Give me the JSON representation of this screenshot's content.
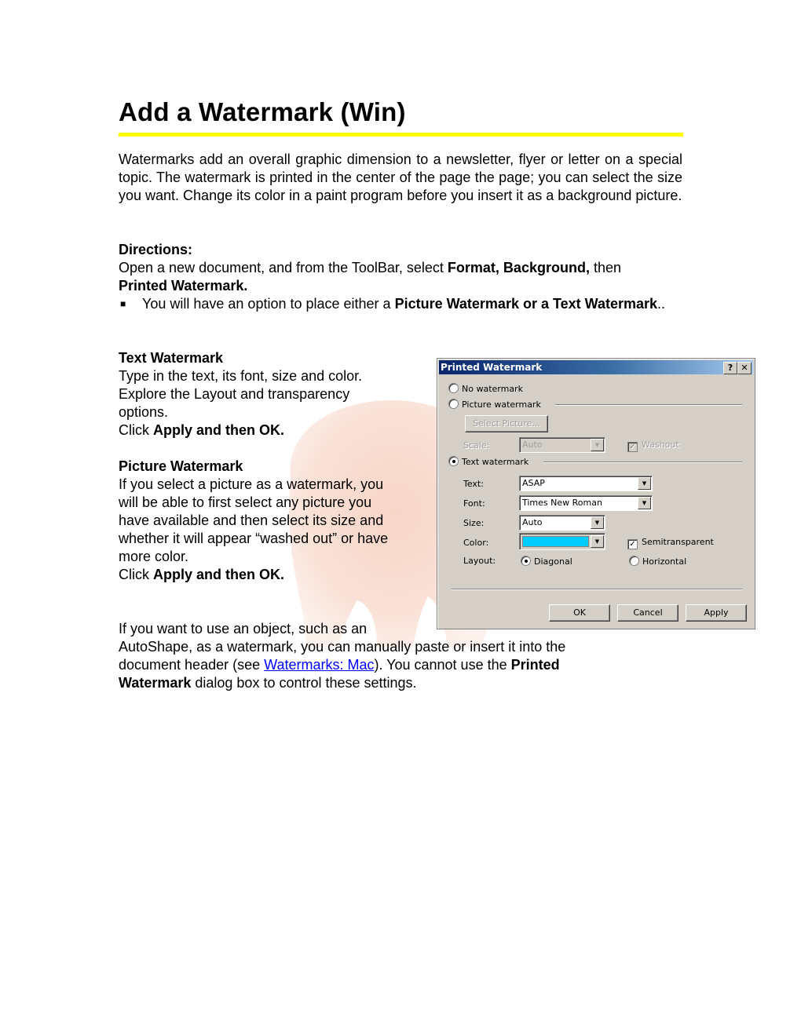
{
  "document": {
    "title": "Add a Watermark (Win)",
    "intro": "Watermarks add an overall graphic dimension to a newsletter, flyer or letter on a special topic. The watermark is printed in the center of the page the page; you can select the size you want. Change its color in a paint program before you insert it as a background picture.",
    "directions": {
      "heading": "Directions:",
      "line1_prefix": "Open a new document, and from the ToolBar, select ",
      "line1_bold": "Format, Background,",
      "line1_suffix": " then",
      "line2_bold": "Printed Watermark.",
      "bullet_glyph": "■",
      "bullet_prefix": "You will have an option to place either a ",
      "bullet_bold": "Picture Watermark or a Text Watermark",
      "bullet_suffix": ".."
    },
    "text_watermark": {
      "heading": "Text Watermark",
      "lines": [
        "Type in the text, its font, size and color.",
        "Explore the Layout and transparency",
        "options."
      ],
      "click_prefix": "Click ",
      "click_bold": "Apply and then OK."
    },
    "picture_watermark": {
      "heading": "Picture Watermark",
      "lines": [
        "If you select a picture as a watermark, you",
        "will be able to first select any picture you",
        "have available and then select its size and",
        "whether it will appear “washed out” or have",
        "more color."
      ],
      "click_prefix": "Click ",
      "click_bold": "Apply and then OK."
    },
    "object_note": {
      "line1": "If you want to use an object, such as an",
      "line2": "AutoShape, as a watermark, you can manually paste or insert it into the",
      "line3_prefix": "document header (see ",
      "link_text": "Watermarks: Mac",
      "line3_suffix": "). You cannot use the ",
      "line3_bold": "Printed",
      "line4_bold": "Watermark",
      "line4_suffix": " dialog box to control these settings."
    },
    "colors": {
      "title_rule": "#ffff00",
      "link": "#0000ff",
      "watermark_tint": "#e8825a"
    }
  },
  "dialog": {
    "title": "Printed Watermark",
    "help_button": "?",
    "close_button": "✕",
    "no_watermark": {
      "label": "No watermark",
      "selected": false
    },
    "picture_watermark": {
      "label": "Picture watermark",
      "selected": false
    },
    "select_picture_button": "Select Picture...",
    "scale_label": "Scale:",
    "scale_value": "Auto",
    "washout": {
      "label": "Washout",
      "checked": true,
      "disabled": true
    },
    "text_watermark": {
      "label": "Text watermark",
      "selected": true
    },
    "text_label": "Text:",
    "text_value": "ASAP",
    "font_label": "Font:",
    "font_value": "Times New Roman",
    "size_label": "Size:",
    "size_value": "Auto",
    "color_label": "Color:",
    "color_value": "#00ccff",
    "semitransparent": {
      "label": "Semitransparent",
      "checked": true
    },
    "layout_label": "Layout:",
    "layout_options": [
      {
        "label": "Diagonal",
        "selected": true
      },
      {
        "label": "Horizontal",
        "selected": false
      }
    ],
    "buttons": {
      "ok": "OK",
      "cancel": "Cancel",
      "apply": "Apply"
    },
    "dropdown_arrow": "▼",
    "check_glyph": "✓"
  }
}
